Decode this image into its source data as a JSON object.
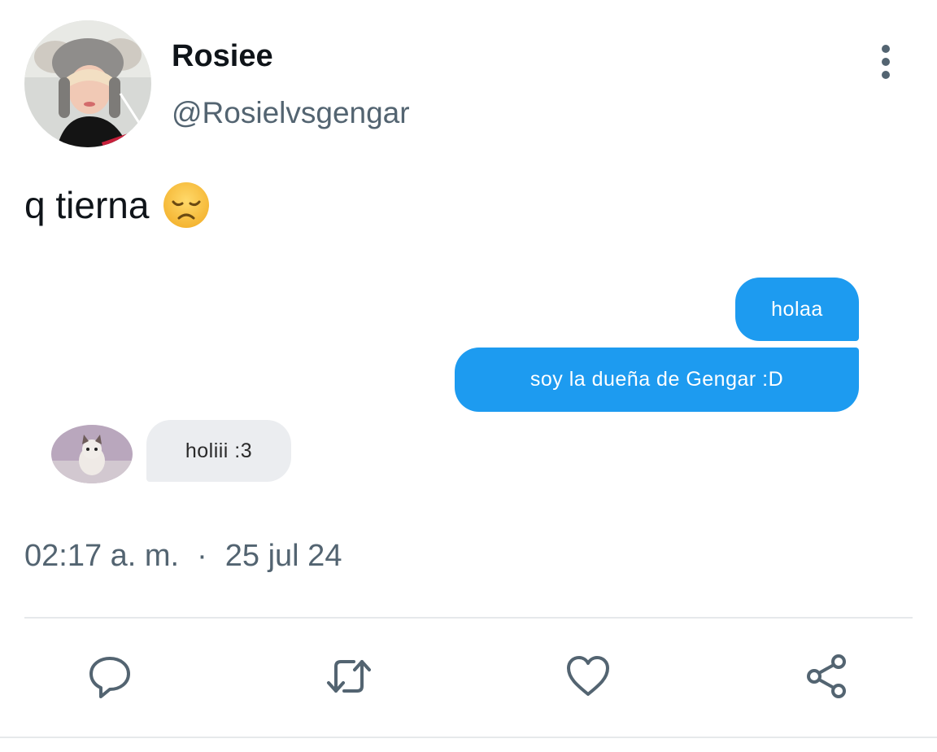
{
  "author": {
    "name": "Rosiee",
    "handle": "@Rosielvsgengar"
  },
  "tweet": {
    "text": "q tierna",
    "emoji": "disappointed-face-emoji"
  },
  "chat": {
    "outgoing": [
      {
        "text": "holaa"
      },
      {
        "text": "soy la dueña de Gengar :D"
      }
    ],
    "incoming": [
      {
        "text": "holiii :3"
      }
    ]
  },
  "meta": {
    "time": "02:17 a. m.",
    "separator": "·",
    "date": "25 jul 24"
  },
  "actions": {
    "icons": [
      "reply-icon",
      "retweet-icon",
      "like-icon",
      "share-icon"
    ]
  },
  "colors": {
    "accent": "#1d9bf0",
    "secondary_text": "#536471",
    "incoming_bubble": "#ebedf0"
  }
}
